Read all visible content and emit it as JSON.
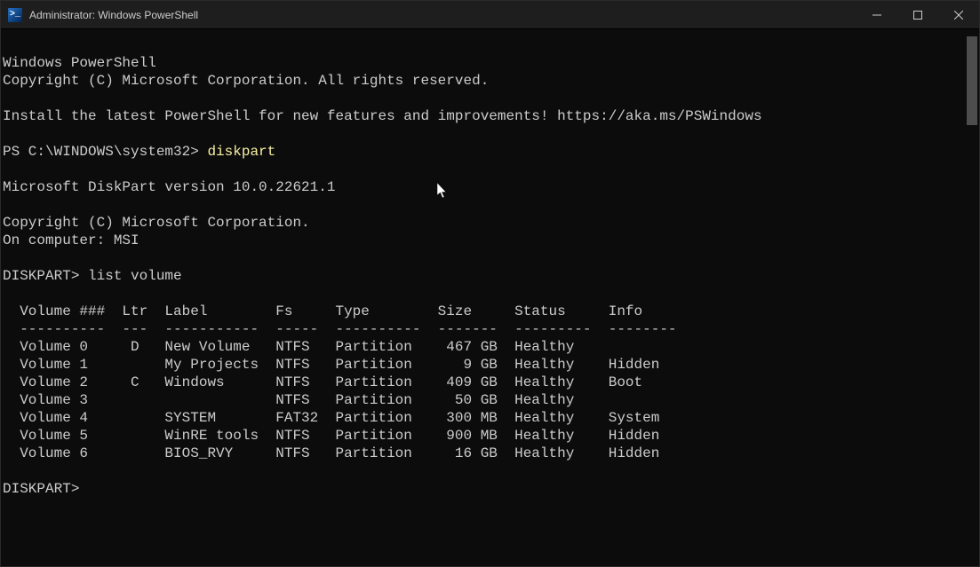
{
  "titlebar": {
    "icon_label": ">_",
    "title": "Administrator: Windows PowerShell"
  },
  "header": {
    "line1": "Windows PowerShell",
    "line2": "Copyright (C) Microsoft Corporation. All rights reserved.",
    "install_msg": "Install the latest PowerShell for new features and improvements! https://aka.ms/PSWindows"
  },
  "prompt1": {
    "path": "PS C:\\WINDOWS\\system32> ",
    "command": "diskpart"
  },
  "diskpart": {
    "version_line": "Microsoft DiskPart version 10.0.22621.1",
    "copyright": "Copyright (C) Microsoft Corporation.",
    "computer": "On computer: MSI"
  },
  "prompt2": {
    "label": "DISKPART> ",
    "command": "list volume"
  },
  "table": {
    "header": "  Volume ###  Ltr  Label        Fs     Type        Size     Status     Info",
    "divider": "  ----------  ---  -----------  -----  ----------  -------  ---------  --------",
    "rows": [
      "  Volume 0     D   New Volume   NTFS   Partition    467 GB  Healthy",
      "  Volume 1         My Projects  NTFS   Partition      9 GB  Healthy    Hidden",
      "  Volume 2     C   Windows      NTFS   Partition    409 GB  Healthy    Boot",
      "  Volume 3                      NTFS   Partition     50 GB  Healthy",
      "  Volume 4         SYSTEM       FAT32  Partition    300 MB  Healthy    System",
      "  Volume 5         WinRE tools  NTFS   Partition    900 MB  Healthy    Hidden",
      "  Volume 6         BIOS_RVY     NTFS   Partition     16 GB  Healthy    Hidden"
    ]
  },
  "prompt3": {
    "label": "DISKPART>"
  }
}
